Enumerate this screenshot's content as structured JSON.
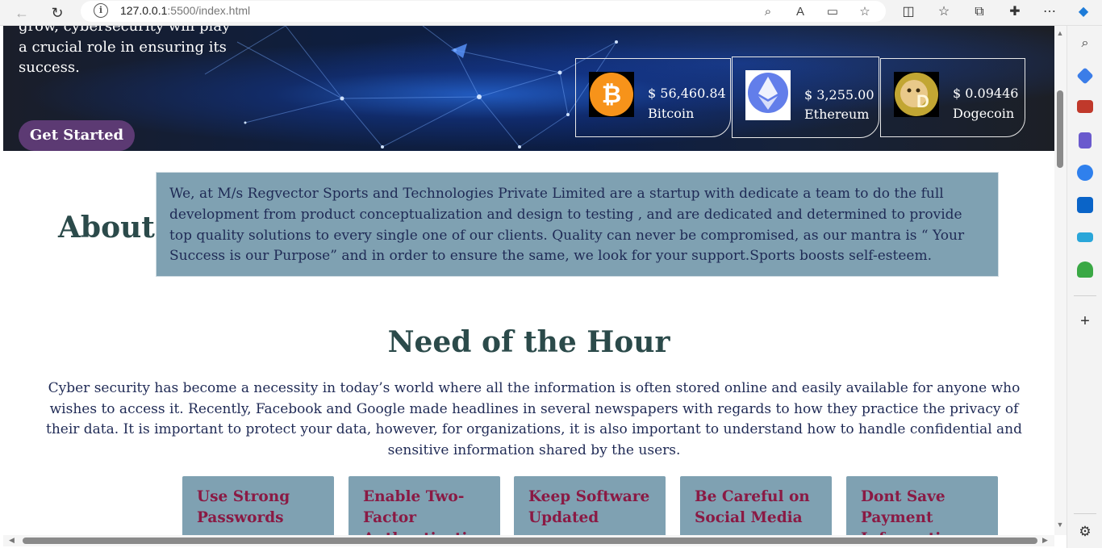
{
  "browser": {
    "url_host": "127.0.0.1",
    "url_rest": ":5500/index.html"
  },
  "hero": {
    "text": "grow, cybersecurity will play a crucial role in ensuring its success.",
    "cta_label": "Get Started"
  },
  "coins": [
    {
      "price": "$ 56,460.84",
      "name": "Bitcoin",
      "color": "#f7931a"
    },
    {
      "price": "$ 3,255.00",
      "name": "Ethereum",
      "color": "#627eea"
    },
    {
      "price": "$ 0.09446",
      "name": "Dogecoin",
      "color": "#c2a633"
    }
  ],
  "about": {
    "title": "About",
    "text": "We, at M/s Regvector Sports and Technologies Private Limited are a startup with dedicate a team to do the full development from product conceptualization and design to testing , and are dedicated and determined to provide top quality solutions to every single one of our clients. Quality can never be compromised, as our mantra is “ Your Success is our Purpose” and in order to ensure the same, we look for your support.Sports boosts self-esteem."
  },
  "need": {
    "title": "Need of the Hour",
    "text": "Cyber security has become a necessity in today’s world where all the information is often stored online and easily available for anyone who wishes to access it. Recently, Facebook and Google made headlines in several newspapers with regards to how they practice the privacy of their data. It is important to protect your data, however, for organizations, it is also important to understand how to handle confidential and sensitive information shared by the users."
  },
  "cards": [
    {
      "title": "Use Strong Passwords"
    },
    {
      "title": "Enable Two-Factor Authentication"
    },
    {
      "title": "Keep Software Updated"
    },
    {
      "title": "Be Careful on Social Media"
    },
    {
      "title": "Dont Save Payment Information"
    }
  ],
  "colors": {
    "heading": "#2b4a4a",
    "body_text": "#1f2a55",
    "box_bg": "#7fa1b2",
    "card_title": "#8a1a44",
    "cta_bg": "#5c3a73"
  }
}
